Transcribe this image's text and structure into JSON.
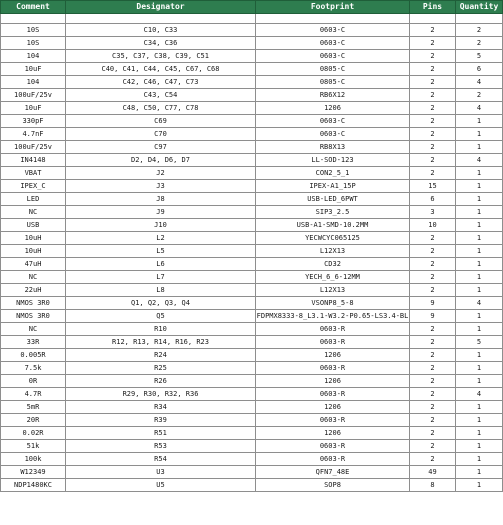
{
  "header": {
    "comment": "Comment",
    "designator": "Designator",
    "footprint": "Footprint",
    "pins": "Pins",
    "quantity": "Quantity"
  },
  "header_color": "#2e7d4f",
  "rows": [
    {
      "comment": "10S",
      "designator": "C10, C33",
      "footprint": "0603-C",
      "pins": "2",
      "quantity": "2"
    },
    {
      "comment": "10S",
      "designator": "C34, C36",
      "footprint": "0603-C",
      "pins": "2",
      "quantity": "2"
    },
    {
      "comment": "104",
      "designator": "C35, C37, C38, C39, C51",
      "footprint": "0603-C",
      "pins": "2",
      "quantity": "5"
    },
    {
      "comment": "10uF",
      "designator": "C40, C41, C44, C45, C67, C68",
      "footprint": "0805-C",
      "pins": "2",
      "quantity": "6"
    },
    {
      "comment": "104",
      "designator": "C42, C46, C47, C73",
      "footprint": "0805-C",
      "pins": "2",
      "quantity": "4"
    },
    {
      "comment": "100uF/25v",
      "designator": "C43, C54",
      "footprint": "RB6X12",
      "pins": "2",
      "quantity": "2"
    },
    {
      "comment": "10uF",
      "designator": "C48, C50, C77, C78",
      "footprint": "1206",
      "pins": "2",
      "quantity": "4"
    },
    {
      "comment": "330pF",
      "designator": "C69",
      "footprint": "0603-C",
      "pins": "2",
      "quantity": "1"
    },
    {
      "comment": "4.7nF",
      "designator": "C70",
      "footprint": "0603-C",
      "pins": "2",
      "quantity": "1"
    },
    {
      "comment": "100uF/25v",
      "designator": "C97",
      "footprint": "RB8X13",
      "pins": "2",
      "quantity": "1"
    },
    {
      "comment": "IN4148",
      "designator": "D2, D4, D6, D7",
      "footprint": "LL-SOD-123",
      "pins": "2",
      "quantity": "4"
    },
    {
      "comment": "VBAT",
      "designator": "J2",
      "footprint": "CON2_5_1",
      "pins": "2",
      "quantity": "1"
    },
    {
      "comment": "IPEX_C",
      "designator": "J3",
      "footprint": "IPEX-A1_15P",
      "pins": "15",
      "quantity": "1"
    },
    {
      "comment": "LED",
      "designator": "J8",
      "footprint": "USB-LED_6PWT",
      "pins": "6",
      "quantity": "1"
    },
    {
      "comment": "NC",
      "designator": "J9",
      "footprint": "SIP3_2.5",
      "pins": "3",
      "quantity": "1"
    },
    {
      "comment": "USB",
      "designator": "J10",
      "footprint": "USB-A1-SMD-10.2MM",
      "pins": "10",
      "quantity": "1"
    },
    {
      "comment": "10uH",
      "designator": "L2",
      "footprint": "YECWCYC065125",
      "pins": "2",
      "quantity": "1"
    },
    {
      "comment": "10uH",
      "designator": "L5",
      "footprint": "L12X13",
      "pins": "2",
      "quantity": "1"
    },
    {
      "comment": "47uH",
      "designator": "L6",
      "footprint": "CD32",
      "pins": "2",
      "quantity": "1"
    },
    {
      "comment": "NC",
      "designator": "L7",
      "footprint": "YECH_6_6-12MM",
      "pins": "2",
      "quantity": "1"
    },
    {
      "comment": "22uH",
      "designator": "L8",
      "footprint": "L12X13",
      "pins": "2",
      "quantity": "1"
    },
    {
      "comment": "NMOS 3R0",
      "designator": "Q1, Q2, Q3, Q4",
      "footprint": "VSONP8_5-8",
      "pins": "9",
      "quantity": "4"
    },
    {
      "comment": "NMOS 3R0",
      "designator": "Q5",
      "footprint": "FDPMX8333-8_L3.1-W3.2-P0.65-LS3.4-BL",
      "pins": "9",
      "quantity": "1"
    },
    {
      "comment": "NC",
      "designator": "R10",
      "footprint": "0603-R",
      "pins": "2",
      "quantity": "1"
    },
    {
      "comment": "33R",
      "designator": "R12, R13, R14, R16, R23",
      "footprint": "0603-R",
      "pins": "2",
      "quantity": "5"
    },
    {
      "comment": "0.005R",
      "designator": "R24",
      "footprint": "1206",
      "pins": "2",
      "quantity": "1"
    },
    {
      "comment": "7.5k",
      "designator": "R25",
      "footprint": "0603-R",
      "pins": "2",
      "quantity": "1"
    },
    {
      "comment": "0R",
      "designator": "R26",
      "footprint": "1206",
      "pins": "2",
      "quantity": "1"
    },
    {
      "comment": "4.7R",
      "designator": "R29, R30, R32, R36",
      "footprint": "0603-R",
      "pins": "2",
      "quantity": "4"
    },
    {
      "comment": "5mR",
      "designator": "R34",
      "footprint": "1206",
      "pins": "2",
      "quantity": "1"
    },
    {
      "comment": "20R",
      "designator": "R39",
      "footprint": "0603-R",
      "pins": "2",
      "quantity": "1"
    },
    {
      "comment": "0.02R",
      "designator": "R51",
      "footprint": "1206",
      "pins": "2",
      "quantity": "1"
    },
    {
      "comment": "51k",
      "designator": "R53",
      "footprint": "0603-R",
      "pins": "2",
      "quantity": "1"
    },
    {
      "comment": "100k",
      "designator": "R54",
      "footprint": "0603-R",
      "pins": "2",
      "quantity": "1"
    },
    {
      "comment": "W12349",
      "designator": "U3",
      "footprint": "QFN7_48E",
      "pins": "49",
      "quantity": "1"
    },
    {
      "comment": "NDP1480KC",
      "designator": "U5",
      "footprint": "SOP8",
      "pins": "8",
      "quantity": "1"
    }
  ]
}
